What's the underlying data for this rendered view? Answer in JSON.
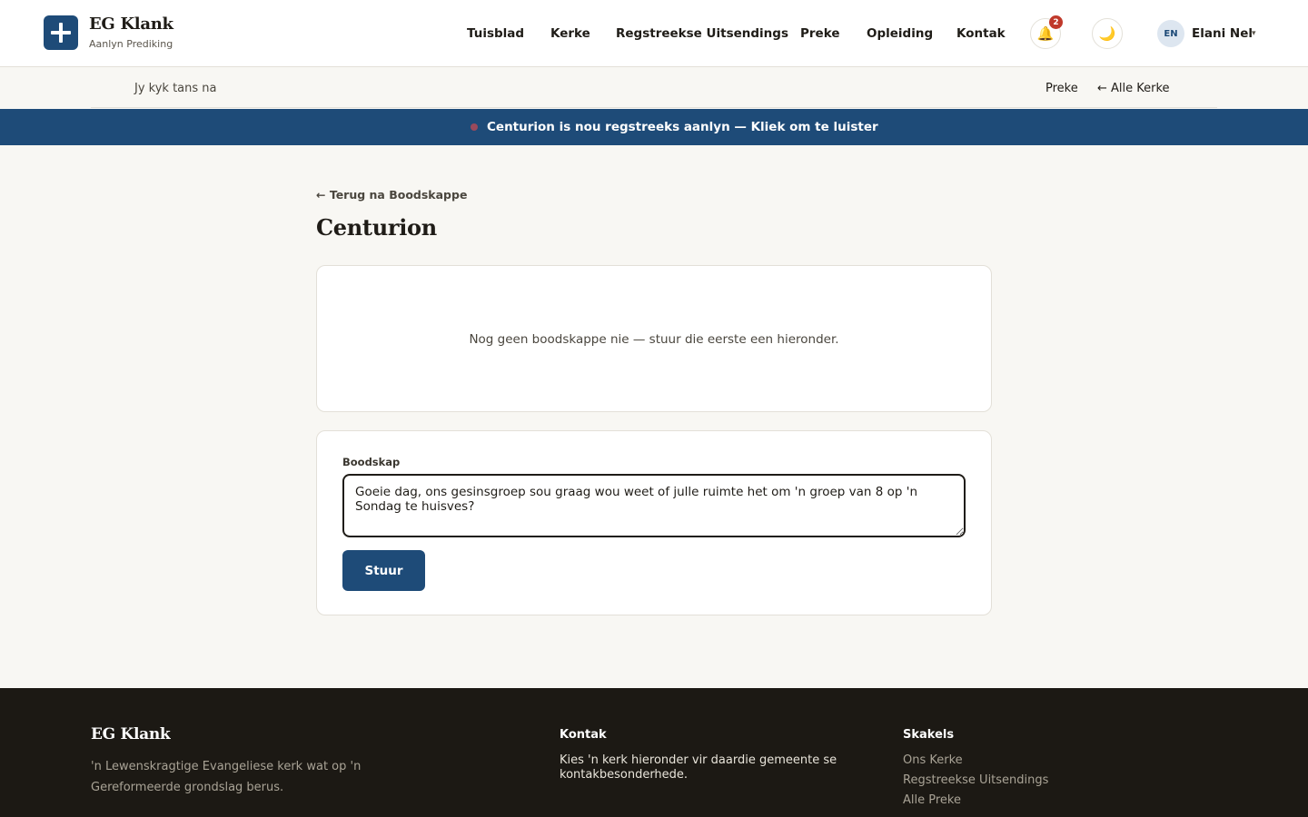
{
  "header": {
    "brand_name": "EG Klank",
    "brand_sub": "Aanlyn Prediking",
    "nav": [
      {
        "label": "Tuisblad"
      },
      {
        "label": "Kerke"
      },
      {
        "label": "Regstreekse Uitsendings"
      },
      {
        "label": "Preke"
      },
      {
        "label": "Opleiding"
      },
      {
        "label": "Kontak"
      }
    ],
    "notification_count": "2",
    "bell_icon": "bell-icon",
    "theme_icon": "moon-icon",
    "language": "EN",
    "user_name": "Elani Nel",
    "user_caret": "▾"
  },
  "subbar": {
    "left_text": "Jy kyk tans na",
    "preke_link": "Preke",
    "all_churches_link": "← Alle Kerke"
  },
  "live_banner": {
    "text": "Centurion is nou regstreeks aanlyn — Kliek om te luister"
  },
  "main": {
    "back_link": "← Terug na Boodskappe",
    "title": "Centurion",
    "empty_state": "Nog geen boodskappe nie — stuur die eerste een hieronder.",
    "form": {
      "label": "Boodskap",
      "message_value": "Goeie dag, ons gesinsgroep sou graag wou weet of julle ruimte het om 'n groep van 8 op 'n Sondag te huisves?",
      "send_label": "Stuur"
    }
  },
  "footer": {
    "brand_name": "EG Klank",
    "tagline": "'n Lewenskragtige Evangeliese kerk wat op 'n Gereformeerde grondslag berus.",
    "contact_heading": "Kontak",
    "contact_text": "Kies 'n kerk hieronder vir daardie gemeente se kontakbesonderhede.",
    "links_heading": "Skakels",
    "links": [
      {
        "label": "Ons Kerke"
      },
      {
        "label": "Regstreekse Uitsendings"
      },
      {
        "label": "Alle Preke"
      }
    ]
  },
  "colors": {
    "brand_blue": "#1e4b78",
    "badge_red": "#c0392b",
    "footer_bg": "#1c1914",
    "page_bg": "#f8f7f3"
  }
}
